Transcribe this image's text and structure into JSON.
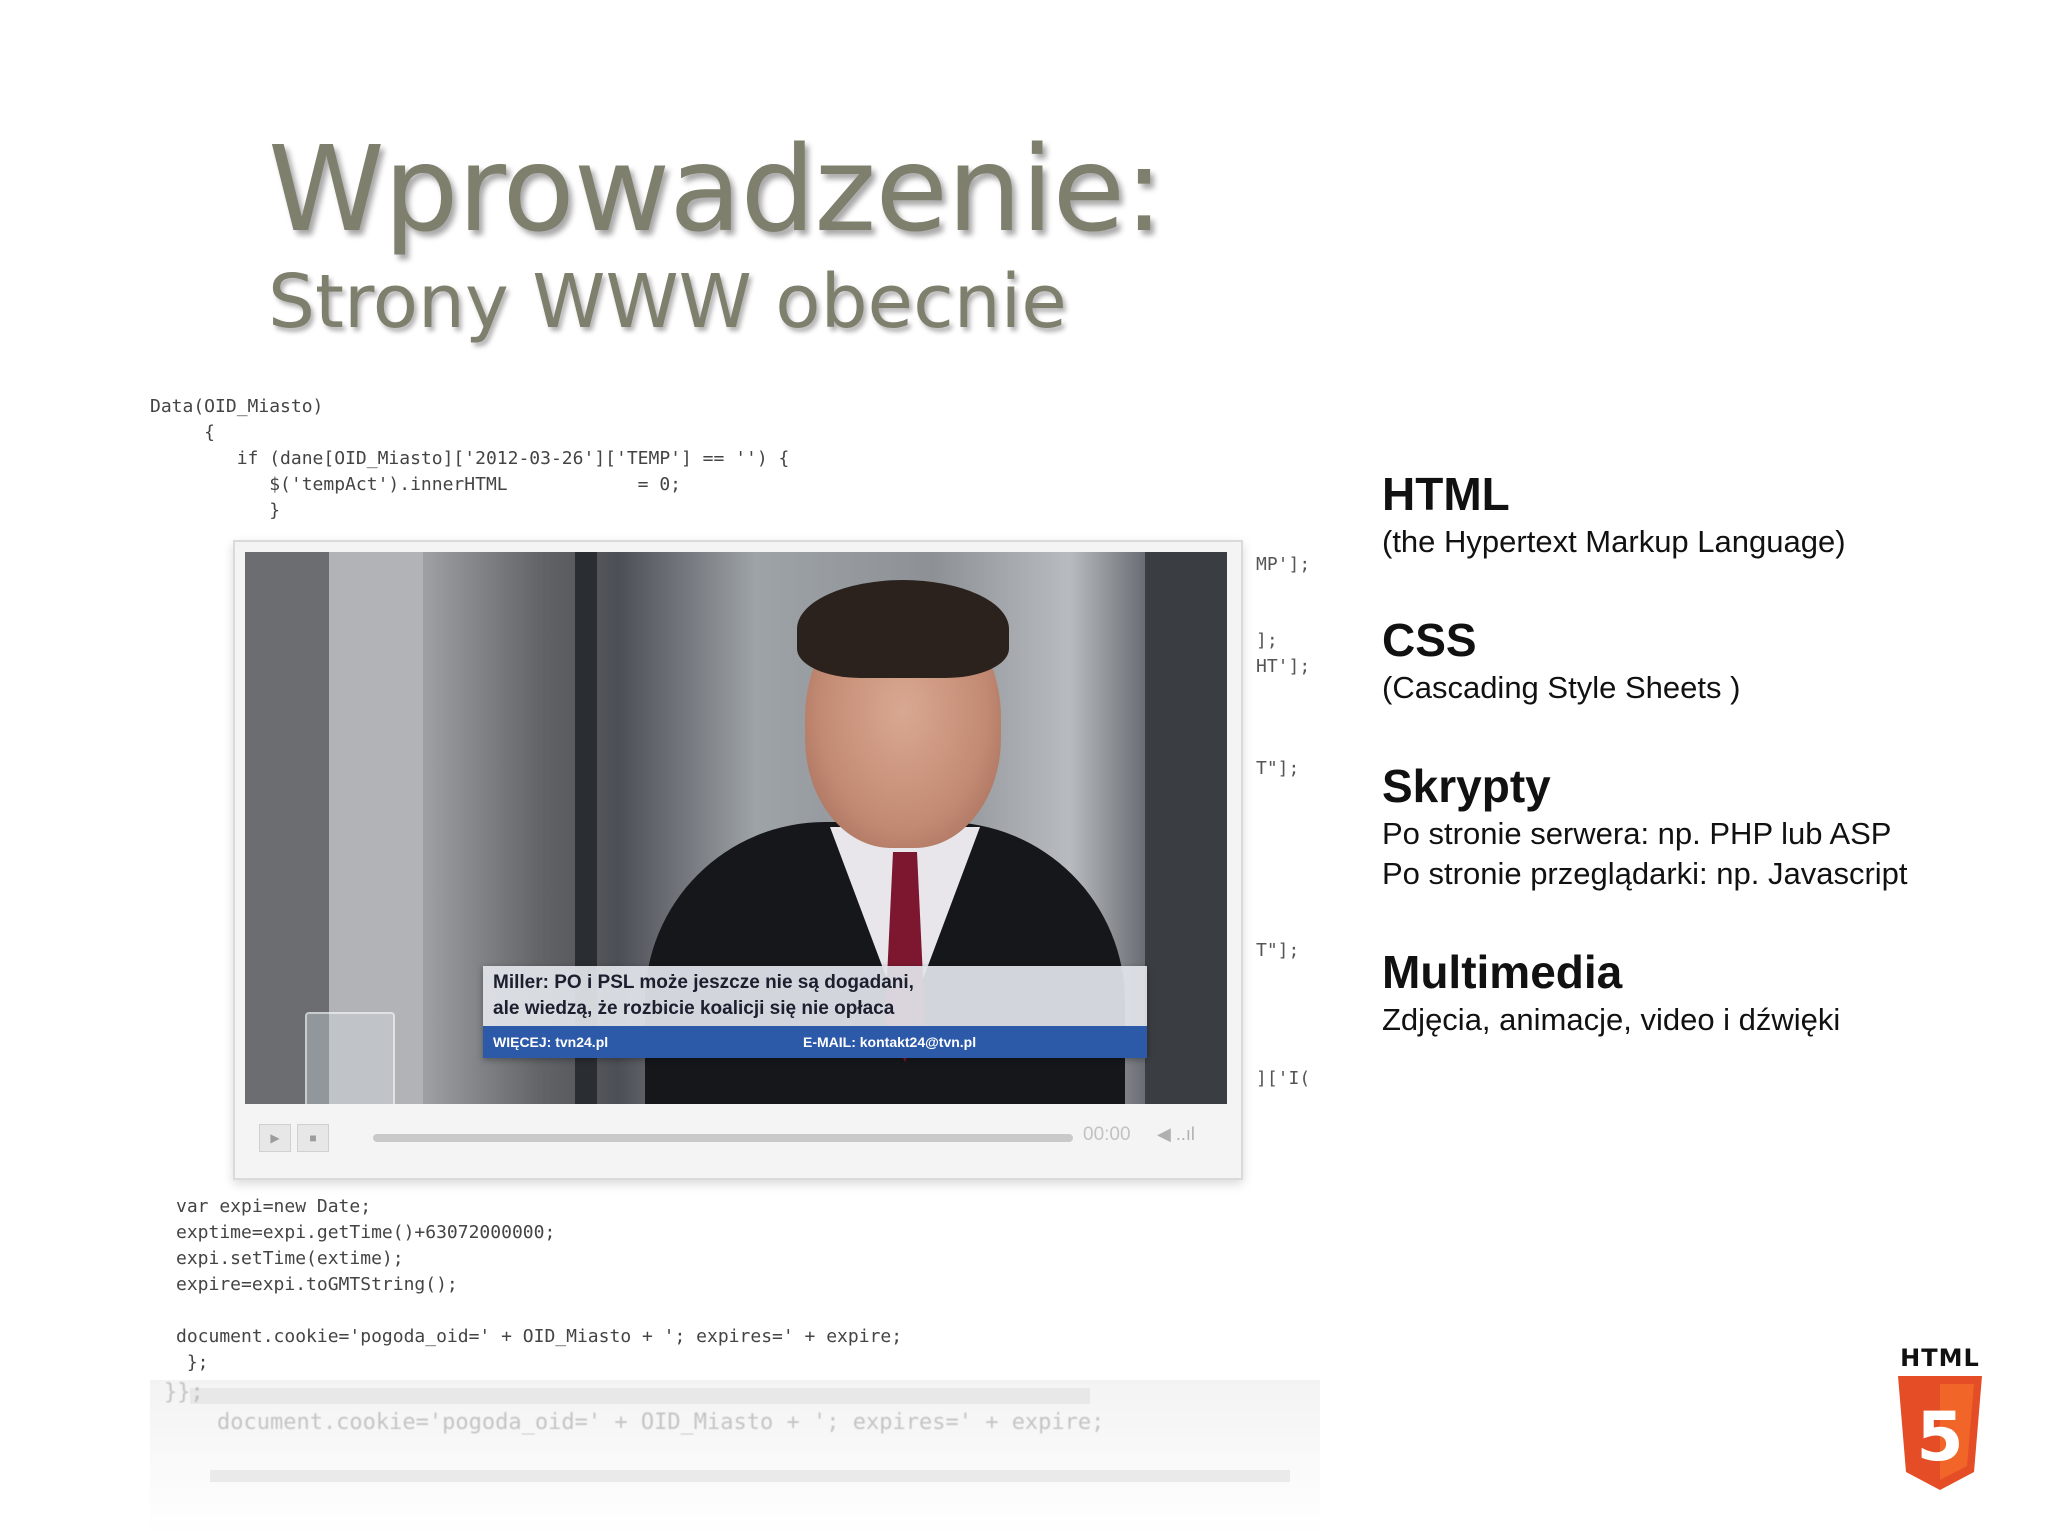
{
  "slide": {
    "title": "Wprowadzenie:",
    "subtitle": "Strony WWW obecnie"
  },
  "code": {
    "top_lines": "Data(OID_Miasto)\n     {\n        if (dane[OID_Miasto]['2012-03-26']['TEMP'] == '') {\n           $('tempAct').innerHTML            = 0;\n           }",
    "side_1": "MP'];",
    "side_2": "];\nHT'];",
    "side_3": "T\"];",
    "side_4": "T\"];",
    "side_5": "]['I(",
    "bottom_lines": "var expi=new Date;\nexptime=expi.getTime()+63072000000;\nexpi.setTime(extime);\nexpire=expi.toGMTString();\n\ndocument.cookie='pogoda_oid=' + OID_Miasto + '; expires=' + expire;\n };",
    "reflection_lines": "}};\n    document.cookie='pogoda_oid=' + OID_Miasto + '; expires=' + expire;"
  },
  "video": {
    "ticker_line_1": "Miller: PO i PSL może jeszcze nie są dogadani,",
    "ticker_line_2": "ale wiedzą, że rozbicie koalicji się nie opłaca",
    "ticker_left": "WIĘCEJ: tvn24.pl",
    "ticker_right": "E-MAIL: kontakt24@tvn.pl",
    "time": "00:00",
    "play_glyph": "▶",
    "stop_glyph": "■",
    "volume_glyph": "◀ ..ıl",
    "progress": 0
  },
  "items": [
    {
      "title": "HTML",
      "lines": [
        "(the Hypertext Markup Language)"
      ]
    },
    {
      "title": "CSS",
      "lines": [
        "(Cascading Style Sheets )"
      ]
    },
    {
      "title": "Skrypty",
      "lines": [
        "Po stronie serwera: np. PHP lub ASP",
        "Po stronie przeglądarki: np. Javascript"
      ]
    },
    {
      "title": "Multimedia",
      "lines": [
        "Zdjęcia, animacje, video i dźwięki"
      ]
    }
  ],
  "logo": {
    "label": "HTML",
    "digit": "5",
    "colors": {
      "shield": "#e44d26",
      "shield_light": "#f16529",
      "digit": "#ffffff"
    }
  },
  "colors": {
    "title": "#7e7f6c",
    "text": "#111111",
    "ticker_bar": "#2d5aa8",
    "tie": "#7d1730"
  }
}
